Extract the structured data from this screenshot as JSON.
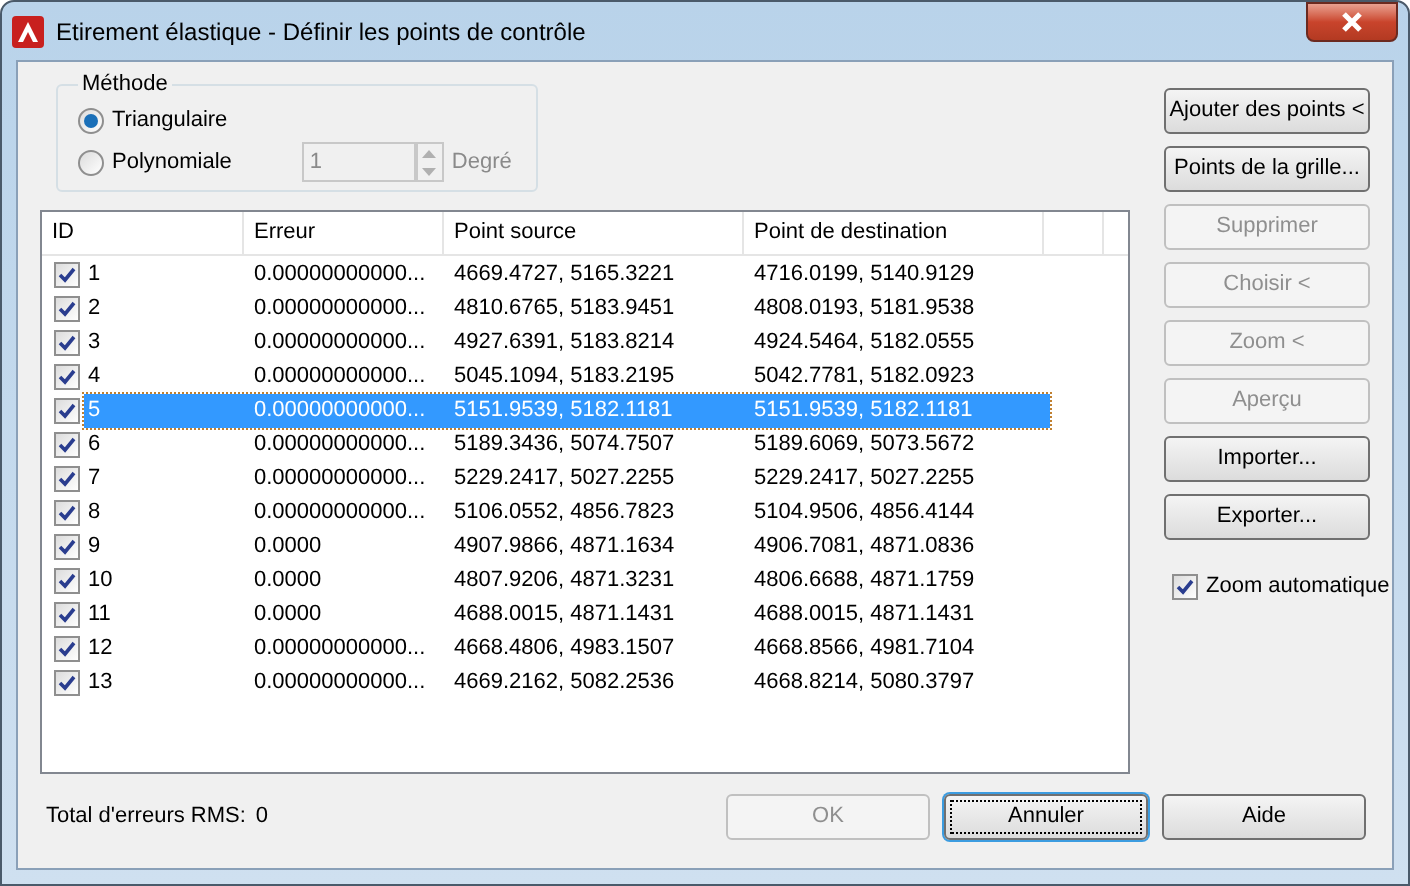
{
  "window": {
    "title": "Etirement élastique - Définir les points de contrôle"
  },
  "method": {
    "legend": "Méthode",
    "options": [
      {
        "label": "Triangulaire",
        "selected": true
      },
      {
        "label": "Polynomiale",
        "selected": false
      }
    ],
    "degree": {
      "value": "1",
      "label": "Degré",
      "disabled": true
    }
  },
  "table": {
    "columns": [
      "ID",
      "Erreur",
      "Point source",
      "Point de destination"
    ],
    "rows": [
      {
        "checked": true,
        "selected": false,
        "cells": [
          "1",
          "0.00000000000...",
          "4669.4727, 5165.3221",
          "4716.0199, 5140.9129"
        ]
      },
      {
        "checked": true,
        "selected": false,
        "cells": [
          "2",
          "0.00000000000...",
          "4810.6765, 5183.9451",
          "4808.0193, 5181.9538"
        ]
      },
      {
        "checked": true,
        "selected": false,
        "cells": [
          "3",
          "0.00000000000...",
          "4927.6391, 5183.8214",
          "4924.5464, 5182.0555"
        ]
      },
      {
        "checked": true,
        "selected": false,
        "cells": [
          "4",
          "0.00000000000...",
          "5045.1094, 5183.2195",
          "5042.7781, 5182.0923"
        ]
      },
      {
        "checked": true,
        "selected": true,
        "cells": [
          "5",
          "0.00000000000...",
          "5151.9539, 5182.1181",
          "5151.9539, 5182.1181"
        ]
      },
      {
        "checked": true,
        "selected": false,
        "cells": [
          "6",
          "0.00000000000...",
          "5189.3436, 5074.7507",
          "5189.6069, 5073.5672"
        ]
      },
      {
        "checked": true,
        "selected": false,
        "cells": [
          "7",
          "0.00000000000...",
          "5229.2417, 5027.2255",
          "5229.2417, 5027.2255"
        ]
      },
      {
        "checked": true,
        "selected": false,
        "cells": [
          "8",
          "0.00000000000...",
          "5106.0552, 4856.7823",
          "5104.9506, 4856.4144"
        ]
      },
      {
        "checked": true,
        "selected": false,
        "cells": [
          "9",
          "0.0000",
          "4907.9866, 4871.1634",
          "4906.7081, 4871.0836"
        ]
      },
      {
        "checked": true,
        "selected": false,
        "cells": [
          "10",
          "0.0000",
          "4807.9206, 4871.3231",
          "4806.6688, 4871.1759"
        ]
      },
      {
        "checked": true,
        "selected": false,
        "cells": [
          "11",
          "0.0000",
          "4688.0015, 4871.1431",
          "4688.0015, 4871.1431"
        ]
      },
      {
        "checked": true,
        "selected": false,
        "cells": [
          "12",
          "0.00000000000...",
          "4668.4806, 4983.1507",
          "4668.8566, 4981.7104"
        ]
      },
      {
        "checked": true,
        "selected": false,
        "cells": [
          "13",
          "0.00000000000...",
          "4669.2162, 5082.2536",
          "4668.8214, 5080.3797"
        ]
      }
    ]
  },
  "side_buttons": [
    {
      "label": "Ajouter des points <",
      "disabled": false
    },
    {
      "label": "Points de la grille...",
      "disabled": false
    },
    {
      "label": "Supprimer",
      "disabled": true
    },
    {
      "label": "Choisir <",
      "disabled": true
    },
    {
      "label": "Zoom <",
      "disabled": true
    },
    {
      "label": "Aperçu",
      "disabled": true
    },
    {
      "label": "Importer...",
      "disabled": false
    },
    {
      "label": "Exporter...",
      "disabled": false
    }
  ],
  "auto_zoom": {
    "label": "Zoom automatique",
    "checked": true
  },
  "rms": {
    "label": "Total d'erreurs RMS:",
    "value": "0"
  },
  "footer_buttons": [
    {
      "label": "OK",
      "disabled": true,
      "default": false
    },
    {
      "label": "Annuler",
      "disabled": false,
      "default": true
    },
    {
      "label": "Aide",
      "disabled": false,
      "default": false
    }
  ]
}
